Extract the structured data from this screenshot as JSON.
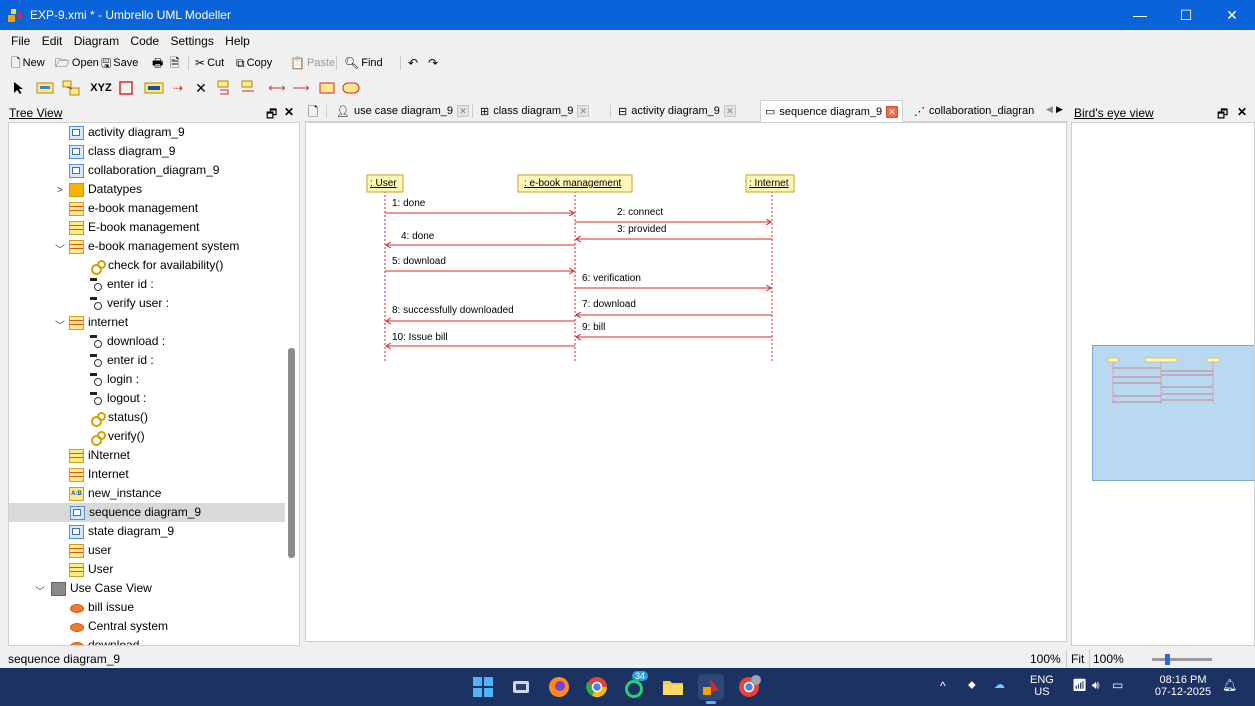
{
  "window": {
    "title": "EXP-9.xmi * - Umbrello UML Modeller",
    "minimize": "—",
    "maximize": "☐",
    "close": "✕"
  },
  "menu": [
    "File",
    "Edit",
    "Diagram",
    "Code",
    "Settings",
    "Help"
  ],
  "toolbar": {
    "new": "New",
    "open": "Open",
    "save": "Save",
    "cut": "Cut",
    "copy": "Copy",
    "paste": "Paste",
    "find": "Find"
  },
  "toolbar2": {
    "xyz": "XYZ"
  },
  "tree_view": {
    "title": "Tree View",
    "items": [
      {
        "label": "activity diagram_9",
        "icon": "diagram-icon"
      },
      {
        "label": "class diagram_9",
        "icon": "diagram-icon"
      },
      {
        "label": "collaboration_diagram_9",
        "icon": "diagram-icon"
      },
      {
        "label": "Datatypes",
        "icon": "folder-icon"
      },
      {
        "label": "e-book management",
        "icon": "class-icon"
      },
      {
        "label": "E-book management",
        "icon": "class-icon"
      },
      {
        "label": "e-book management system",
        "icon": "class-icon"
      },
      {
        "label": "check for availability()",
        "icon": "operation-icon"
      },
      {
        "label": "enter id :",
        "icon": "attribute-icon"
      },
      {
        "label": "verify user :",
        "icon": "attribute-icon"
      },
      {
        "label": "internet",
        "icon": "class-icon"
      },
      {
        "label": "download :",
        "icon": "attribute-icon"
      },
      {
        "label": "enter id :",
        "icon": "attribute-icon"
      },
      {
        "label": "login :",
        "icon": "attribute-icon"
      },
      {
        "label": "logout :",
        "icon": "attribute-icon"
      },
      {
        "label": "status()",
        "icon": "operation-icon"
      },
      {
        "label": "verify()",
        "icon": "operation-icon"
      },
      {
        "label": "iNternet",
        "icon": "class-icon"
      },
      {
        "label": "Internet",
        "icon": "class-icon"
      },
      {
        "label": "new_instance",
        "icon": "instance-icon"
      },
      {
        "label": "sequence diagram_9",
        "icon": "diagram-icon",
        "selected": true
      },
      {
        "label": "state diagram_9",
        "icon": "diagram-icon"
      },
      {
        "label": "user",
        "icon": "class-icon"
      },
      {
        "label": "User",
        "icon": "class-icon"
      },
      {
        "label": "Use Case View",
        "icon": "folder-icon"
      },
      {
        "label": "bill issue",
        "icon": "usecase-icon"
      },
      {
        "label": "Central system",
        "icon": "usecase-icon"
      },
      {
        "label": "download",
        "icon": "usecase-icon"
      }
    ]
  },
  "tabs": [
    {
      "label": "use case diagram_9"
    },
    {
      "label": "class diagram_9"
    },
    {
      "label": "activity diagram_9"
    },
    {
      "label": "sequence diagram_9",
      "active": true
    },
    {
      "label": "collaboration_diagran"
    }
  ],
  "diagram": {
    "objects": [
      ": User",
      ": e-book management",
      ": Internet"
    ],
    "messages": [
      "1: done",
      "2: connect",
      "3: provided",
      "4: done",
      "5: download",
      "6: verification",
      "7: download",
      "8: successfully downloaded",
      "9: bill",
      "10: Issue bill"
    ]
  },
  "birds_eye": {
    "title": "Bird's eye view"
  },
  "status": {
    "text": "sequence diagram_9",
    "zoom": "100%",
    "fit": "Fit",
    "zoom2": "100%"
  },
  "taskbar": {
    "badge": "34",
    "lang_top": "ENG",
    "lang_bottom": "US",
    "time": "08:16 PM",
    "date": "07-12-2025"
  }
}
